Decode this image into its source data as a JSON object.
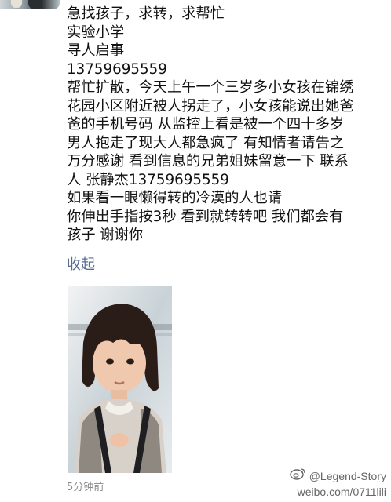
{
  "post": {
    "lines": [
      "急找孩子，求转，求帮忙",
      "实验小学",
      "寻人启事",
      "13759695559",
      "帮忙扩散，今天上午一个三岁多小女孩在锦绣",
      "花园小区附近被人拐走了，小女孩能说出她爸",
      "爸的手机号码 从监控上看是被一个四十多岁",
      "男人抱走了现大人都急疯了 有知情者请告之",
      "万分感谢 看到信息的兄弟姐妹留意一下 联系",
      "人 张静杰13759695559",
      "如果看一眼懒得转的冷漠的人也请",
      "你伸出手指按3秒 看到就转转吧 我们都会有",
      "孩子 谢谢你"
    ],
    "collapse_label": "收起",
    "timestamp": "5分钟前"
  },
  "watermark": {
    "handle": "@Legend-Story",
    "url": "weibo.com/0711lili"
  },
  "colors": {
    "link": "#586b95",
    "text": "#111111",
    "muted": "#8a8a8a"
  }
}
